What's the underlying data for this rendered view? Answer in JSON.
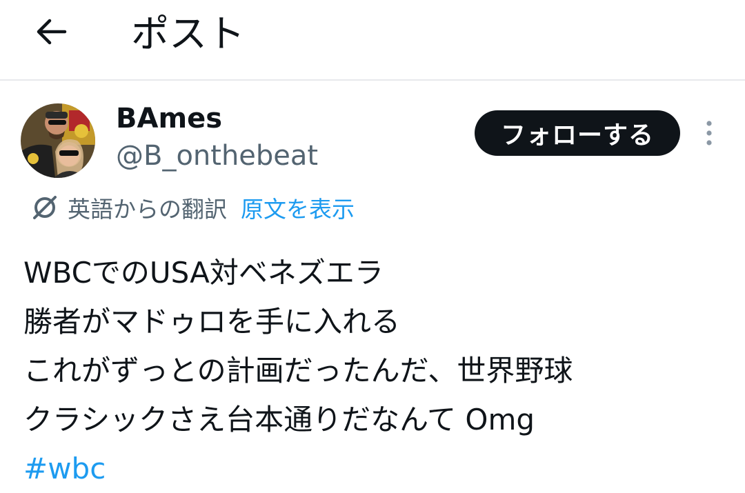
{
  "header": {
    "title": "ポスト",
    "back_icon": "arrow-left-icon"
  },
  "author": {
    "display_name": "BAmes",
    "handle": "@B_onthebeat",
    "avatar_icon": "avatar"
  },
  "actions": {
    "follow_label": "フォローする",
    "more_icon": "more-vertical-icon"
  },
  "translation": {
    "icon": "translate-icon",
    "label": "英語からの翻訳",
    "show_original_label": "原文を表示"
  },
  "tweet": {
    "lines": [
      "WBCでのUSA対ベネズエラ",
      "勝者がマドゥロを手に入れる",
      "これがずっとの計画だったんだ、世界野球",
      "クラシックさえ台本通りだなんて Omg"
    ],
    "hashtag": "#wbc"
  },
  "colors": {
    "text": "#0f1419",
    "secondary": "#536471",
    "link": "#1d9bf0",
    "button_bg": "#0f1419",
    "divider": "#e7e9ec"
  }
}
